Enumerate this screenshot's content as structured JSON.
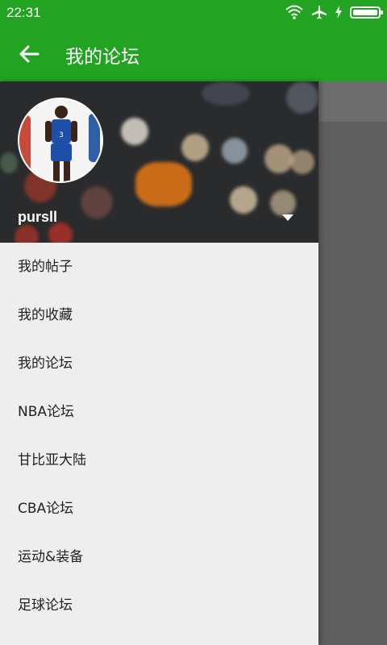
{
  "status_bar": {
    "time": "22:31"
  },
  "app_bar": {
    "title": "我的论坛"
  },
  "drawer": {
    "username": "pursll",
    "menu": [
      {
        "label": "我的帖子"
      },
      {
        "label": "我的收藏"
      },
      {
        "label": "我的论坛"
      },
      {
        "label": "NBA论坛"
      },
      {
        "label": "甘比亚大陆"
      },
      {
        "label": "CBA论坛"
      },
      {
        "label": "运动&装备"
      },
      {
        "label": "足球论坛"
      }
    ]
  },
  "colors": {
    "primary": "#23a322",
    "drawer_bg": "#eeeeee",
    "scrim": "#5f5f5f"
  },
  "icons": [
    "wifi-icon",
    "airplane-mode-icon",
    "charging-icon",
    "battery-icon",
    "back-arrow-icon",
    "dropdown-arrow-icon"
  ]
}
